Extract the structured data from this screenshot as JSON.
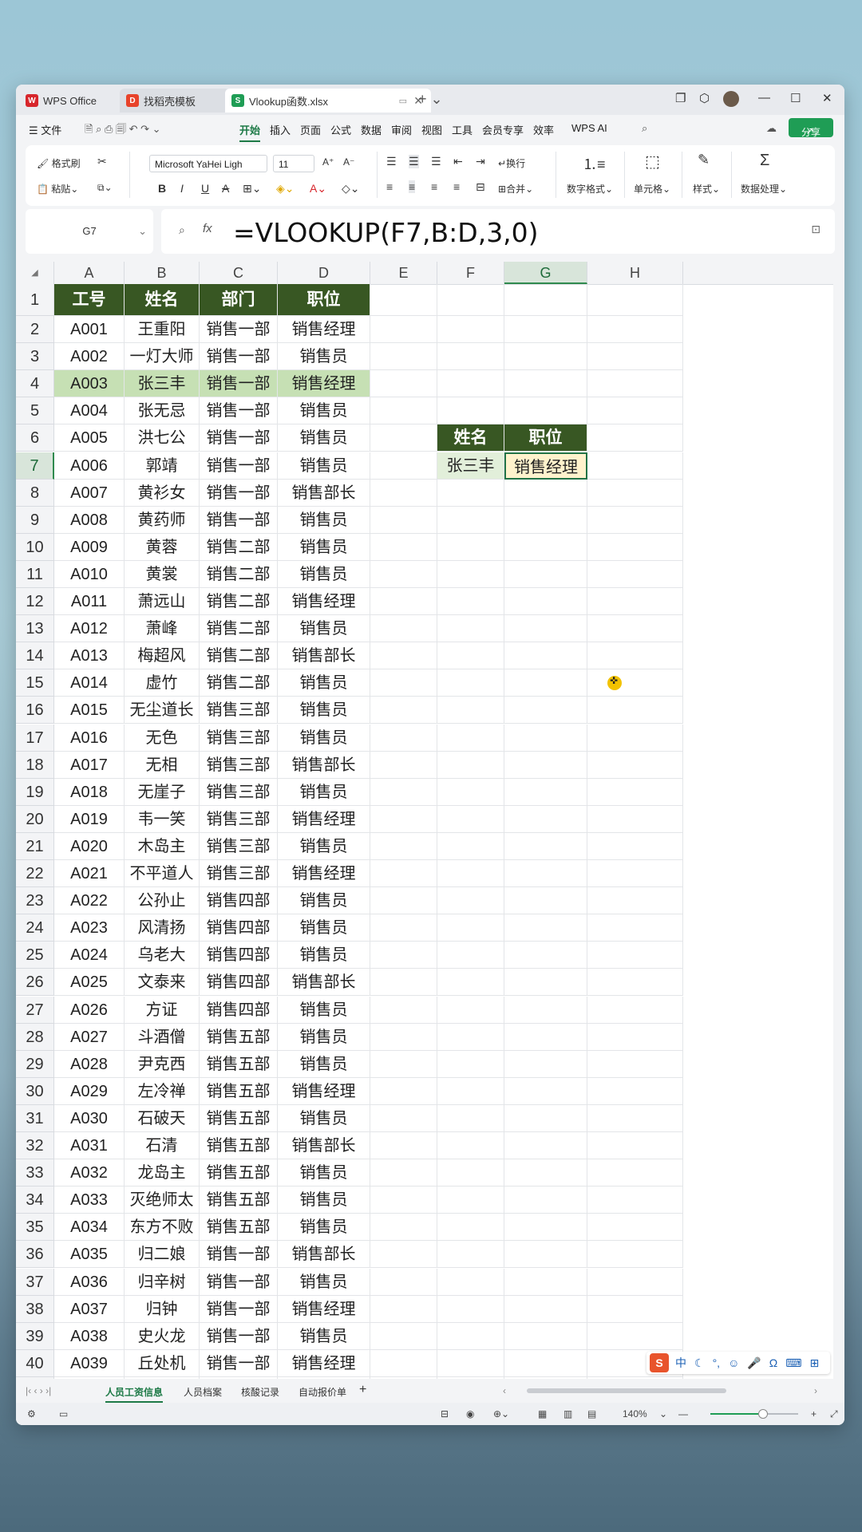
{
  "window": {
    "tabs": [
      {
        "label": "WPS Office",
        "icon": "wps-logo-icon"
      },
      {
        "label": "找稻壳模板",
        "icon": "docer-icon"
      },
      {
        "label": "Vlookup函数.xlsx",
        "icon": "spreadsheet-icon"
      }
    ]
  },
  "menu": {
    "file": "☰ 文件",
    "items": [
      "开始",
      "插入",
      "页面",
      "公式",
      "数据",
      "审阅",
      "视图",
      "工具",
      "会员专享",
      "效率",
      "WPS AI"
    ],
    "share": "分享"
  },
  "ribbon": {
    "format_painter": "格式刷",
    "paste": "粘贴",
    "font_name": "Microsoft YaHei Ligh",
    "font_size": "11",
    "wrap": "换行",
    "merge": "合并",
    "number_format": "数字格式",
    "cell": "单元格",
    "style": "样式",
    "data_processing": "数据处理"
  },
  "formula_bar": {
    "name_box": "G7",
    "formula": "=VLOOKUP(F7,B:D,3,0)"
  },
  "grid": {
    "columns": [
      "A",
      "B",
      "C",
      "D",
      "E",
      "F",
      "G",
      "H"
    ],
    "selected_column": "G",
    "selected_row": "7",
    "headers": [
      "工号",
      "姓名",
      "部门",
      "职位"
    ],
    "rows": [
      [
        "A001",
        "王重阳",
        "销售一部",
        "销售经理"
      ],
      [
        "A002",
        "一灯大师",
        "销售一部",
        "销售员"
      ],
      [
        "A003",
        "张三丰",
        "销售一部",
        "销售经理"
      ],
      [
        "A004",
        "张无忌",
        "销售一部",
        "销售员"
      ],
      [
        "A005",
        "洪七公",
        "销售一部",
        "销售员"
      ],
      [
        "A006",
        "郭靖",
        "销售一部",
        "销售员"
      ],
      [
        "A007",
        "黄衫女",
        "销售一部",
        "销售部长"
      ],
      [
        "A008",
        "黄药师",
        "销售一部",
        "销售员"
      ],
      [
        "A009",
        "黄蓉",
        "销售二部",
        "销售员"
      ],
      [
        "A010",
        "黄裳",
        "销售二部",
        "销售员"
      ],
      [
        "A011",
        "萧远山",
        "销售二部",
        "销售经理"
      ],
      [
        "A012",
        "萧峰",
        "销售二部",
        "销售员"
      ],
      [
        "A013",
        "梅超风",
        "销售二部",
        "销售部长"
      ],
      [
        "A014",
        "虚竹",
        "销售二部",
        "销售员"
      ],
      [
        "A015",
        "无尘道长",
        "销售三部",
        "销售员"
      ],
      [
        "A016",
        "无色",
        "销售三部",
        "销售员"
      ],
      [
        "A017",
        "无相",
        "销售三部",
        "销售部长"
      ],
      [
        "A018",
        "无崖子",
        "销售三部",
        "销售员"
      ],
      [
        "A019",
        "韦一笑",
        "销售三部",
        "销售经理"
      ],
      [
        "A020",
        "木岛主",
        "销售三部",
        "销售员"
      ],
      [
        "A021",
        "不平道人",
        "销售三部",
        "销售经理"
      ],
      [
        "A022",
        "公孙止",
        "销售四部",
        "销售员"
      ],
      [
        "A023",
        "风清扬",
        "销售四部",
        "销售员"
      ],
      [
        "A024",
        "乌老大",
        "销售四部",
        "销售员"
      ],
      [
        "A025",
        "文泰来",
        "销售四部",
        "销售部长"
      ],
      [
        "A026",
        "方证",
        "销售四部",
        "销售员"
      ],
      [
        "A027",
        "斗酒僧",
        "销售五部",
        "销售员"
      ],
      [
        "A028",
        "尹克西",
        "销售五部",
        "销售员"
      ],
      [
        "A029",
        "左冷禅",
        "销售五部",
        "销售经理"
      ],
      [
        "A030",
        "石破天",
        "销售五部",
        "销售员"
      ],
      [
        "A031",
        "石清",
        "销售五部",
        "销售部长"
      ],
      [
        "A032",
        "龙岛主",
        "销售五部",
        "销售员"
      ],
      [
        "A033",
        "灭绝师太",
        "销售五部",
        "销售员"
      ],
      [
        "A034",
        "东方不败",
        "销售五部",
        "销售员"
      ],
      [
        "A035",
        "归二娘",
        "销售一部",
        "销售部长"
      ],
      [
        "A036",
        "归辛树",
        "销售一部",
        "销售员"
      ],
      [
        "A037",
        "归钟",
        "销售一部",
        "销售经理"
      ],
      [
        "A038",
        "史火龙",
        "销售一部",
        "销售员"
      ],
      [
        "A039",
        "丘处机",
        "销售一部",
        "销售经理"
      ]
    ],
    "highlighted_row": "A003",
    "lookup": {
      "header_name": "姓名",
      "header_position": "职位",
      "name": "张三丰",
      "result": "销售经理"
    }
  },
  "ime": {
    "label": "中"
  },
  "sheet_tabs": [
    "人员工资信息",
    "人员档案",
    "核酸记录",
    "自动报价单"
  ],
  "active_sheet": "人员工资信息",
  "status": {
    "zoom": "140%"
  },
  "colors": {
    "header_bg": "#385723",
    "highlight_row": "#c6e0b4",
    "accent": "#1f9d55"
  }
}
